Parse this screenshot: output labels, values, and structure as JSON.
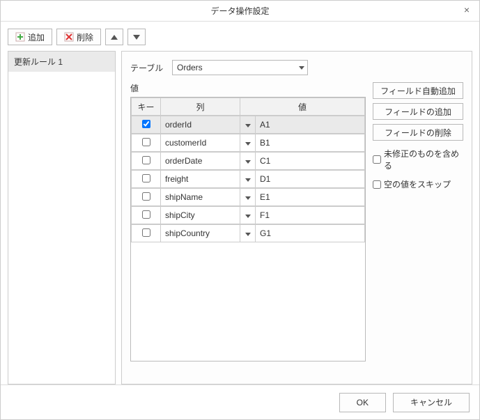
{
  "title": "データ操作設定",
  "toolbar": {
    "add": "追加",
    "delete": "削除"
  },
  "sidebar": {
    "items": [
      {
        "label": "更新ルール 1"
      }
    ]
  },
  "main": {
    "table_label": "テーブル",
    "table_value": "Orders",
    "values_label": "値",
    "columns": {
      "key": "キー",
      "col": "列",
      "val": "値"
    },
    "rows": [
      {
        "key": true,
        "col": "orderId",
        "val": "A1"
      },
      {
        "key": false,
        "col": "customerId",
        "val": "B1"
      },
      {
        "key": false,
        "col": "orderDate",
        "val": "C1"
      },
      {
        "key": false,
        "col": "freight",
        "val": "D1"
      },
      {
        "key": false,
        "col": "shipName",
        "val": "E1"
      },
      {
        "key": false,
        "col": "shipCity",
        "val": "F1"
      },
      {
        "key": false,
        "col": "shipCountry",
        "val": "G1"
      }
    ],
    "actions": {
      "auto_add": "フィールド自動追加",
      "add_field": "フィールドの追加",
      "del_field": "フィールドの削除",
      "include_unmodified": "未修正のものを含める",
      "skip_empty": "空の値をスキップ"
    }
  },
  "footer": {
    "ok": "OK",
    "cancel": "キャンセル"
  }
}
